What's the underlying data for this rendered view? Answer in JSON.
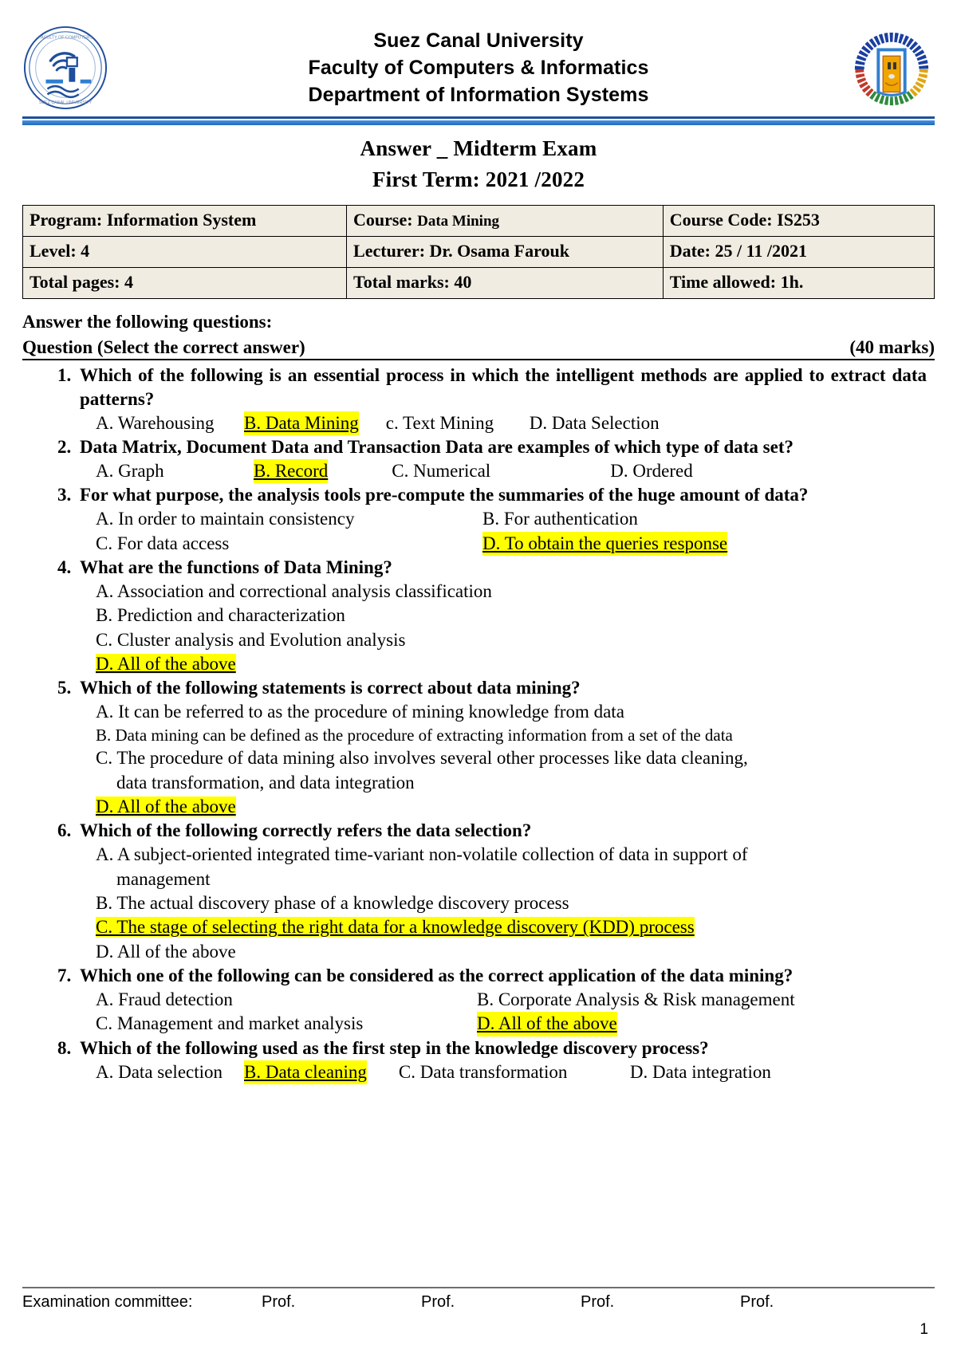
{
  "header": {
    "university": "Suez Canal University",
    "faculty": "Faculty of  Computers & Informatics",
    "department": "Department of  Information Systems",
    "left_logo_name": "faculty-of-computers-and-informatics-seal",
    "right_logo_name": "suez-canal-university-seal",
    "rule_color_top": "#1f4e9c",
    "rule_color_bottom": "#2f7fd0"
  },
  "title": {
    "exam": "Answer _ Midterm Exam",
    "term": "First Term: 2021 /2022"
  },
  "info_table": {
    "rows": [
      [
        {
          "label": "Program:  Information System",
          "small": ""
        },
        {
          "label": "Course: ",
          "small": "Data Mining"
        },
        {
          "label": "Course Code: IS253",
          "small": ""
        }
      ],
      [
        {
          "label": "Level: 4",
          "small": ""
        },
        {
          "label": "Lecturer: Dr. Osama Farouk",
          "small": ""
        },
        {
          "label": "Date: 25 / 11 /2021",
          "small": ""
        }
      ],
      [
        {
          "label": "Total pages: 4",
          "small": ""
        },
        {
          "label": "Total marks:  40",
          "small": ""
        },
        {
          "label": "Time allowed: 1h.",
          "small": ""
        }
      ]
    ]
  },
  "instructions": {
    "answer_line": "Answer the following questions:",
    "question_heading": "Question  (Select the correct answer)",
    "marks": "(40 marks)"
  },
  "questions": [
    {
      "num": "1.",
      "text": "Which of the following is an essential process in which the intelligent methods are applied to extract data patterns?",
      "opts": {
        "a": "A. Warehousing",
        "b": "B. Data Mining",
        "c": "c. Text Mining",
        "d": "D. Data Selection"
      },
      "answer": "B"
    },
    {
      "num": "2.",
      "text": "Data Matrix, Document Data and Transaction Data are examples of which type of data set?",
      "opts": {
        "a": "A. Graph",
        "b": "B. Record",
        "c": "C. Numerical",
        "d": "D. Ordered"
      },
      "answer": "B"
    },
    {
      "num": "3.",
      "text": "For what purpose, the analysis tools pre-compute the summaries of the huge amount of data?",
      "opts": {
        "a": "A. In order to maintain consistency",
        "b": "B. For authentication",
        "c": "C. For data access",
        "d": "D. To obtain the queries response"
      },
      "answer": "D"
    },
    {
      "num": "4.",
      "text": "What are the functions of Data Mining?",
      "opts": {
        "a": "A. Association and correctional analysis classification",
        "b": "B. Prediction and characterization",
        "c": "C. Cluster analysis and Evolution analysis",
        "d": "D. All of the above"
      },
      "answer": "D"
    },
    {
      "num": "5.",
      "text": "Which of the following statements is correct about data mining?",
      "opts": {
        "a": "A. It can be referred to as the procedure of mining knowledge from data",
        "b": "B. Data mining can be defined as the procedure of extracting information from a set of the data",
        "c": "C. The procedure of data mining also involves several other processes like data cleaning,",
        "c_cont": "data transformation, and data integration",
        "d": "D. All of the above"
      },
      "answer": "D"
    },
    {
      "num": "6.",
      "text": "Which of the following correctly refers the data selection?",
      "opts": {
        "a": "A. A subject-oriented integrated time-variant non-volatile collection of data in support of",
        "a_cont": "management",
        "b": "B. The actual discovery phase of a knowledge discovery process",
        "c": "C. The stage of selecting the right data for a knowledge discovery (KDD) process",
        "d": "D. All of the above"
      },
      "answer": "C"
    },
    {
      "num": "7.",
      "text": "Which one of the following can be considered as the correct application of the data mining?",
      "opts": {
        "a": "A. Fraud detection",
        "b": "B. Corporate Analysis & Risk management",
        "c": "C. Management and market analysis",
        "d": "D. All of the above"
      },
      "answer": "D"
    },
    {
      "num": "8.",
      "text": "Which of the following used as the first step in the knowledge discovery process?",
      "opts": {
        "a": "A. Data selection",
        "b": "B. Data cleaning",
        "c": "C. Data transformation",
        "d": "D. Data integration"
      },
      "answer": "B"
    }
  ],
  "footer": {
    "committee_label": "Examination committee:",
    "prof1": "Prof.",
    "prof2": "Prof.",
    "prof3": "Prof.",
    "prof4": "Prof.",
    "page_number": "1"
  },
  "colors": {
    "highlight": "#ffff00",
    "table_bg": "#f0ece1",
    "rule_blue": "#2f7fd0"
  }
}
